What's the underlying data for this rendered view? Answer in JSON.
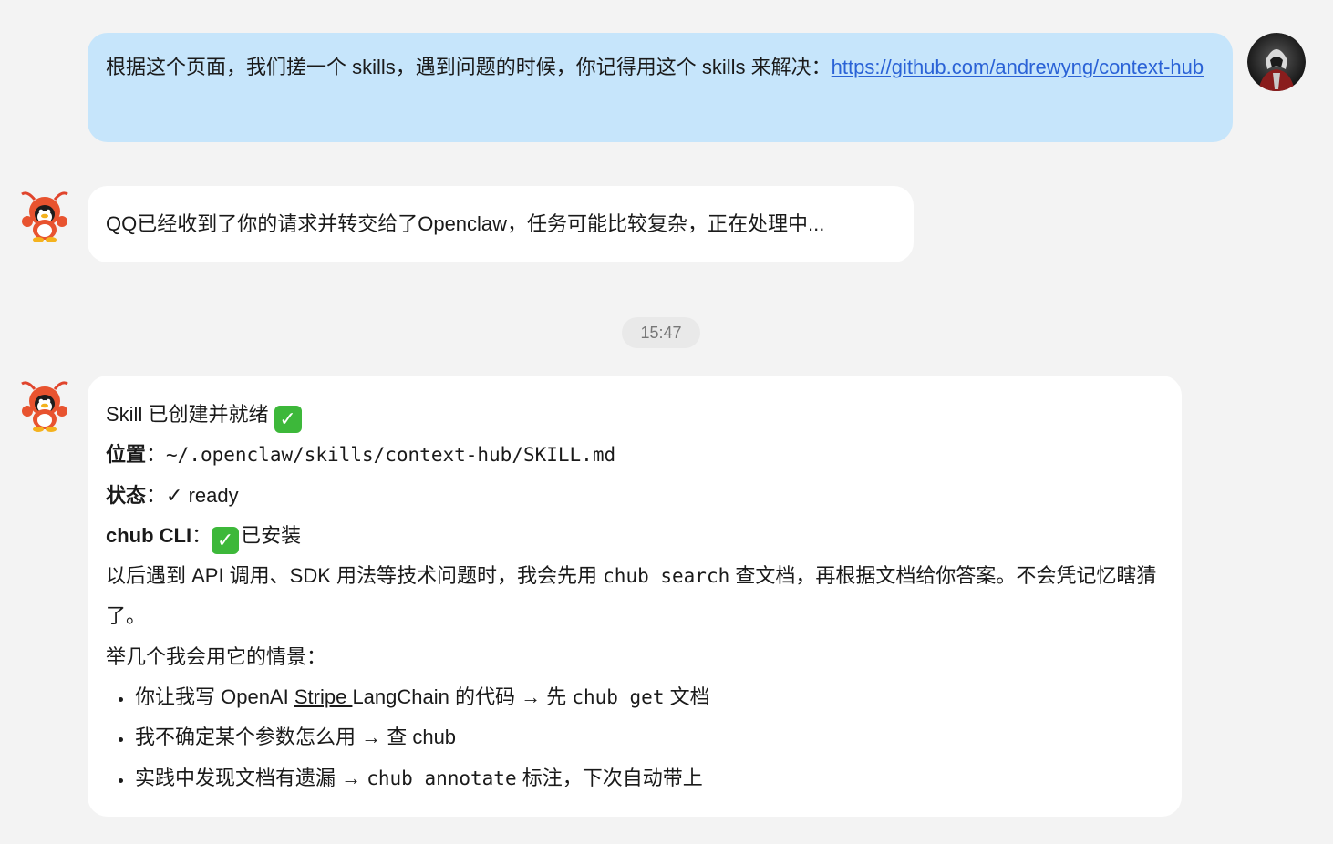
{
  "user_message": {
    "text": "根据这个页面，我们搓一个 skills，遇到问题的时候，你记得用这个 skills 来解决：",
    "link": "https://github.com/andrewyng/context-hub"
  },
  "bot_message_1": {
    "text": "QQ已经收到了你的请求并转交给了Openclaw，任务可能比较复杂，正在处理中..."
  },
  "timestamp": "15:47",
  "bot_message_2": {
    "line1": "Skill 已创建并就绪",
    "location_label": "位置",
    "location_value": "~/.openclaw/skills/context-hub/SKILL.md",
    "status_label": "状态",
    "status_value": "✓ ready",
    "cli_label": "chub CLI",
    "cli_value": "已安装",
    "para_a": "以后遇到 API 调用、SDK 用法等技术问题时，我会先用 ",
    "para_code": "chub search",
    "para_b": " 查文档，再根据文档给你答案。不会凭记忆瞎猜了。",
    "scenario_intro": "举几个我会用它的情景：",
    "bullets": [
      {
        "a": "你让我写 OpenAI ",
        "link": "Stripe ",
        "b": "LangChain 的代码 → 先 ",
        "code": "chub get",
        "c": " 文档"
      },
      {
        "a": "我不确定某个参数怎么用 → 查 chub"
      },
      {
        "a": "实践中发现文档有遗漏 → ",
        "code": "chub annotate",
        "b": " 标注，下次自动带上"
      }
    ]
  },
  "colors": {
    "background": "#f3f3f3",
    "user_bubble": "#c6e5fb",
    "bot_bubble": "#ffffff",
    "link": "#2a62d6",
    "check": "#3db83a"
  }
}
